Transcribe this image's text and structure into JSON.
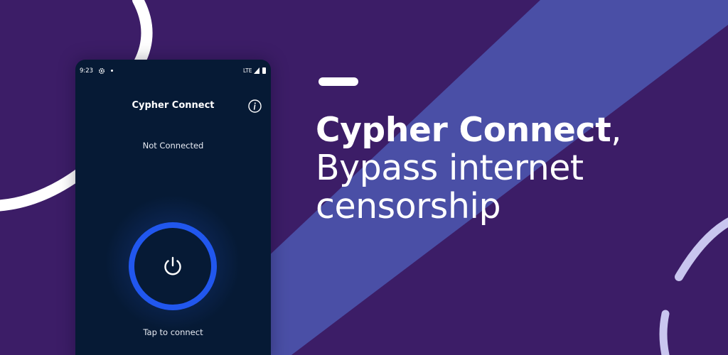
{
  "status_bar": {
    "time": "9:23",
    "network": "LTE",
    "icons": [
      "gear-icon",
      "notification-dot-icon",
      "signal-icon",
      "battery-icon"
    ]
  },
  "app": {
    "title": "Cypher Connect",
    "info_icon": "info-icon",
    "connection_status": "Not Connected",
    "power_icon": "power-icon",
    "tap_label": "Tap to connect"
  },
  "promo": {
    "brand": "Cypher Connect",
    "brand_punctuation": ",",
    "line2": "Bypass internet",
    "line3": "censorship"
  },
  "colors": {
    "background": "#3c1d67",
    "stripe": "#4a4fa6",
    "phone_screen": "#061a35",
    "power_ring": "#2157ee",
    "text": "#ffffff"
  }
}
